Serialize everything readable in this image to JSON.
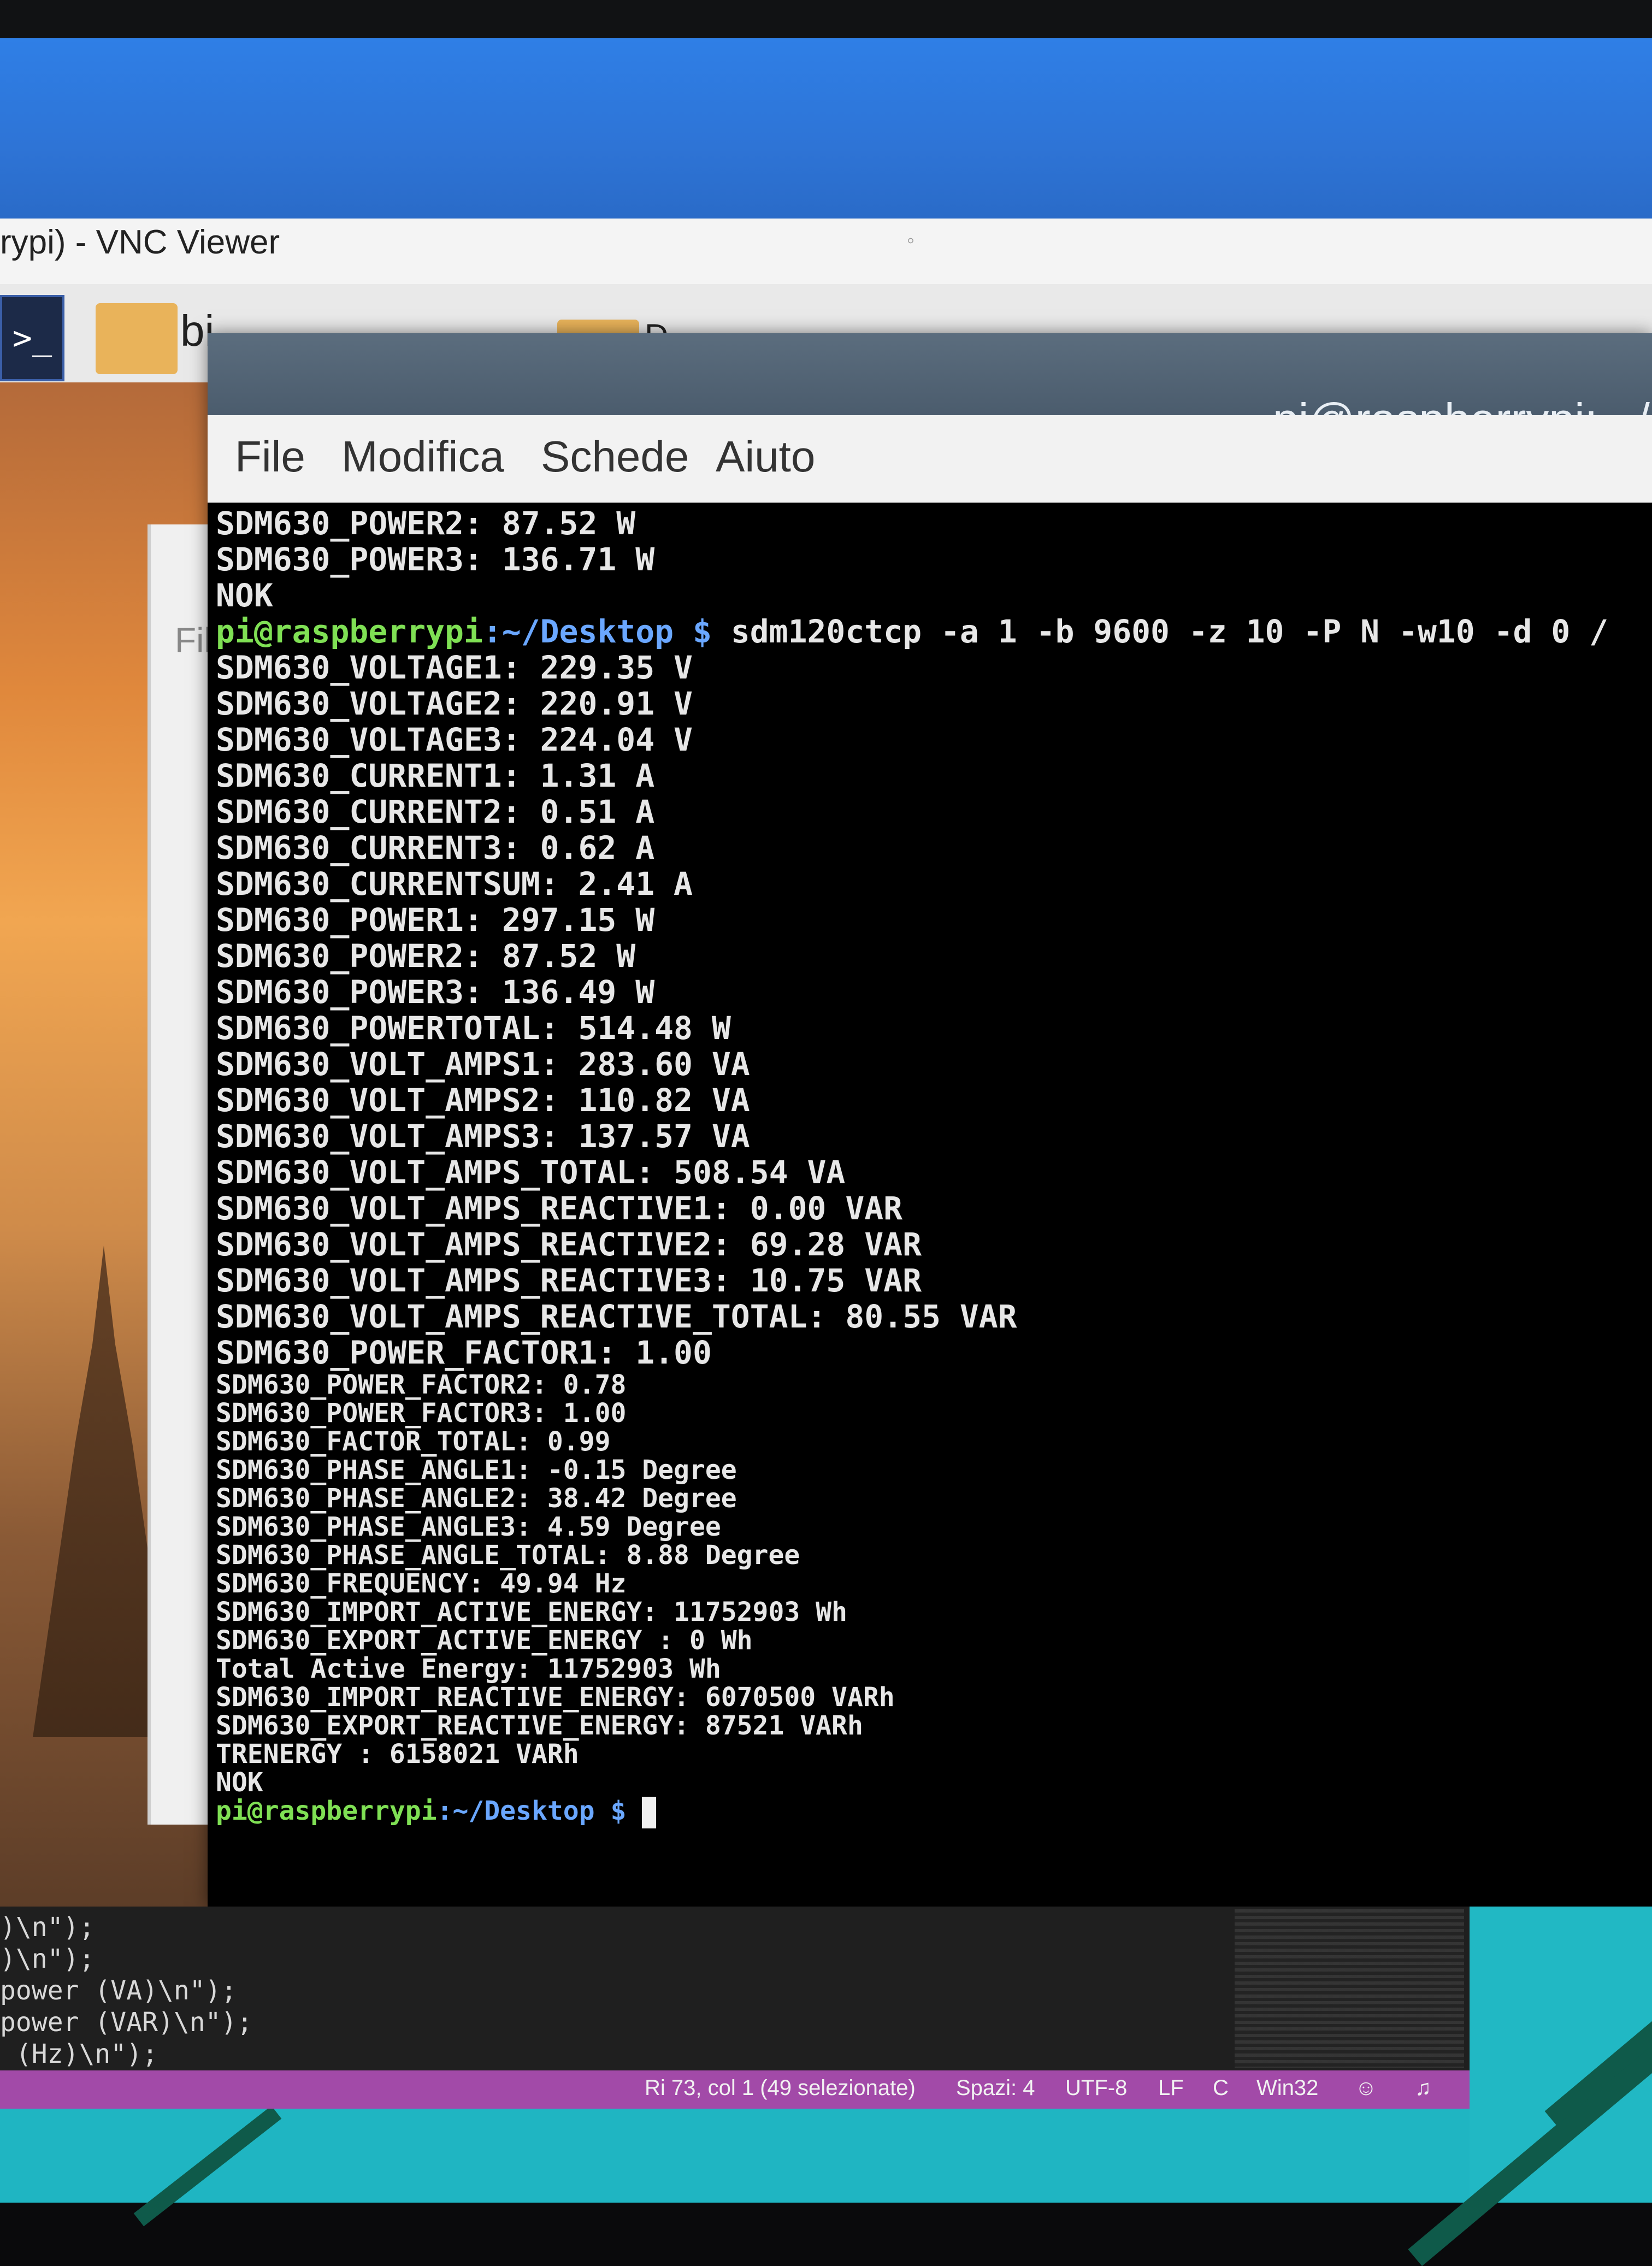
{
  "vnc": {
    "title": "rypi) - VNC Viewer"
  },
  "taskbar": {
    "terminal_icon": ">_",
    "folder1_label": "bi",
    "folder2_label": "D"
  },
  "filemanager": {
    "partial_label": "Fil"
  },
  "terminal": {
    "title": "pi@raspberrypi: ~/De",
    "menu": [
      "File",
      "Modifica",
      "Schede",
      "Aiuto"
    ],
    "prompt_user": "pi@raspberrypi",
    "prompt_path": ":~/Desktop $",
    "command": " sdm120ctcp -a 1 -b 9600 -z 10 -P N -w10 -d 0 /",
    "lines_before": [
      "SDM630_POWER2: 87.52 W",
      "SDM630_POWER3: 136.71 W",
      "NOK"
    ],
    "lines_after": [
      "SDM630_VOLTAGE1: 229.35 V",
      "SDM630_VOLTAGE2: 220.91 V",
      "SDM630_VOLTAGE3: 224.04 V",
      "SDM630_CURRENT1: 1.31 A",
      "SDM630_CURRENT2: 0.51 A",
      "SDM630_CURRENT3: 0.62 A",
      "SDM630_CURRENTSUM: 2.41 A",
      "SDM630_POWER1: 297.15 W",
      "SDM630_POWER2: 87.52 W",
      "SDM630_POWER3: 136.49 W",
      "SDM630_POWERTOTAL: 514.48 W",
      "SDM630_VOLT_AMPS1: 283.60 VA",
      "SDM630_VOLT_AMPS2: 110.82 VA",
      "SDM630_VOLT_AMPS3: 137.57 VA",
      "SDM630_VOLT_AMPS_TOTAL: 508.54 VA",
      "SDM630_VOLT_AMPS_REACTIVE1: 0.00 VAR",
      "SDM630_VOLT_AMPS_REACTIVE2: 69.28 VAR",
      "SDM630_VOLT_AMPS_REACTIVE3: 10.75 VAR",
      "SDM630_VOLT_AMPS_REACTIVE_TOTAL: 80.55 VAR",
      "SDM630_POWER_FACTOR1: 1.00",
      "SDM630_POWER_FACTOR2: 0.78",
      "SDM630_POWER_FACTOR3: 1.00",
      "SDM630_FACTOR_TOTAL: 0.99",
      "SDM630_PHASE_ANGLE1: -0.15 Degree",
      "SDM630_PHASE_ANGLE2: 38.42 Degree",
      "SDM630_PHASE_ANGLE3: 4.59 Degree",
      "SDM630_PHASE_ANGLE_TOTAL: 8.88 Degree",
      "SDM630_FREQUENCY: 49.94 Hz",
      "SDM630_IMPORT_ACTIVE_ENERGY: 11752903 Wh",
      "SDM630_EXPORT_ACTIVE_ENERGY : 0 Wh",
      "Total Active Energy: 11752903 Wh",
      "SDM630_IMPORT_REACTIVE_ENERGY: 6070500 VARh",
      "SDM630_EXPORT_REACTIVE_ENERGY: 87521 VARh",
      "TRENERGY : 6158021 VARh",
      "NOK"
    ],
    "final_prompt_user": "pi@raspberrypi",
    "final_prompt_path": ":~/Desktop $"
  },
  "editor": {
    "code_lines": [
      ")\\n\");",
      ")\\n\");",
      "power (VA)\\n\");",
      "power (VAR)\\n\");",
      " (Hz)\\n\");"
    ]
  },
  "statusbar": {
    "position": "Ri 73, col 1 (49 selezionate)",
    "spaces": "Spazi: 4",
    "encoding": "UTF-8",
    "eol": "LF",
    "language": "C",
    "platform": "Win32"
  }
}
